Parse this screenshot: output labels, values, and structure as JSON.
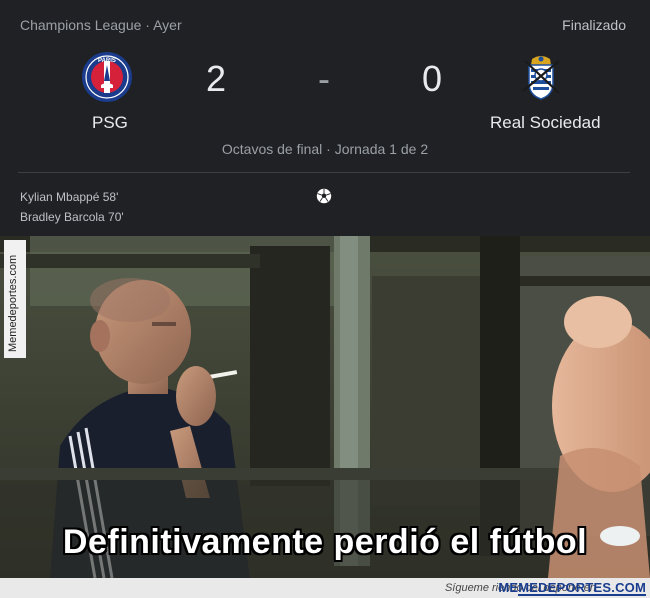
{
  "match": {
    "league": "Champions League · Ayer",
    "status": "Finalizado",
    "home_team": "PSG",
    "away_team": "Real Sociedad",
    "home_score": "2",
    "separator": "-",
    "away_score": "0",
    "stage": "Octavos de final · Jornada 1 de 2",
    "scorers": [
      "Kylian Mbappé 58'",
      "Bradley Barcola 70'"
    ]
  },
  "meme": {
    "side_watermark": "Memedeportes.com",
    "caption": "Definitivamente perdió el fútbol",
    "footer_text": "Sígueте riendo del deporte en",
    "footer_brand": "MEMEDEPORTES.COM"
  },
  "icons": {
    "home_logo": "psg-crest-icon",
    "away_logo": "real-sociedad-crest-icon",
    "goal": "soccer-ball-icon"
  },
  "colors": {
    "background": "#202124",
    "psg_blue": "#1b3c8c",
    "psg_red": "#d5213a",
    "rs_blue": "#1e4f9c"
  }
}
